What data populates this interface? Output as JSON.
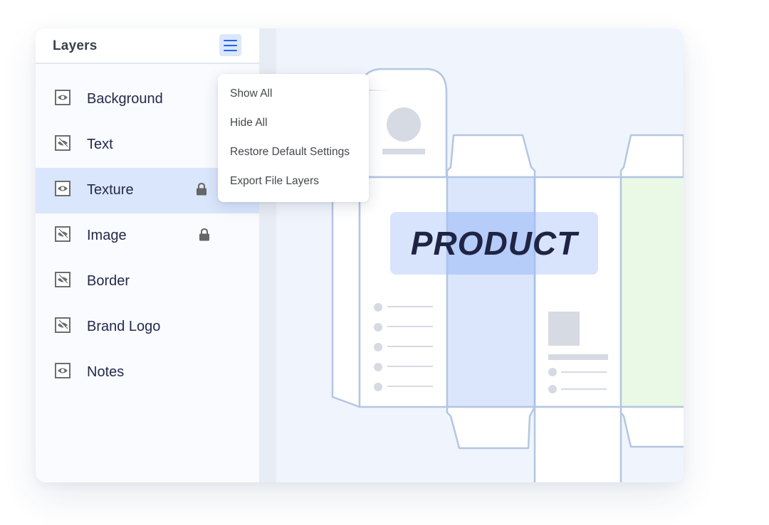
{
  "panel": {
    "title": "Layers",
    "menu_icon": "hamburger-menu-icon",
    "layers": [
      {
        "label": "Background",
        "visible": true,
        "locked": false,
        "selected": false
      },
      {
        "label": "Text",
        "visible": false,
        "locked": false,
        "selected": false
      },
      {
        "label": "Texture",
        "visible": true,
        "locked": true,
        "selected": true
      },
      {
        "label": "Image",
        "visible": false,
        "locked": true,
        "selected": false
      },
      {
        "label": "Border",
        "visible": false,
        "locked": false,
        "selected": false
      },
      {
        "label": "Brand Logo",
        "visible": false,
        "locked": false,
        "selected": false
      },
      {
        "label": "Notes",
        "visible": true,
        "locked": false,
        "selected": false
      }
    ]
  },
  "menu": {
    "items": [
      {
        "label": "Show All"
      },
      {
        "label": "Hide All"
      },
      {
        "label": "Restore Default Settings"
      },
      {
        "label": "Export File Layers"
      }
    ]
  },
  "canvas": {
    "product_label": "PRODUCT"
  },
  "colors": {
    "accent": "#2563eb",
    "selected_row": "#dae6fc",
    "dieline": "#b4c6e2",
    "texture_highlight": "#dbe6fd",
    "green_panel": "#eaf8e6",
    "placeholder": "#d5dae3",
    "icon_gray": "#6e6e6e",
    "text_dark": "#25294a"
  }
}
